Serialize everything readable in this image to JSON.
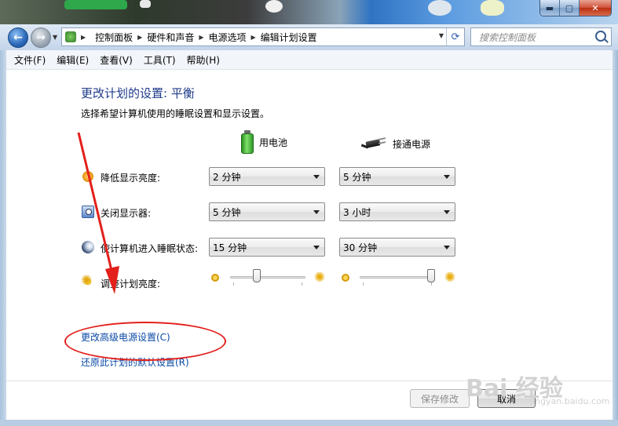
{
  "window": {
    "minimize_glyph": "▬",
    "maximize_glyph": "▢",
    "close_glyph": "✕"
  },
  "nav": {
    "breadcrumbs": [
      "控制面板",
      "硬件和声音",
      "电源选项",
      "编辑计划设置"
    ],
    "search_placeholder": "搜索控制面板"
  },
  "menu": [
    "文件(F)",
    "编辑(E)",
    "查看(V)",
    "工具(T)",
    "帮助(H)"
  ],
  "plan": {
    "title": "更改计划的设置: 平衡",
    "subtitle": "选择希望计算机使用的睡眠设置和显示设置。",
    "col_battery": "用电池",
    "col_plugged": "接通电源",
    "rows": [
      {
        "label": "降低显示亮度:",
        "battery": "2 分钟",
        "plugged": "5 分钟",
        "icon": "dim-display-icon"
      },
      {
        "label": "关闭显示器:",
        "battery": "5 分钟",
        "plugged": "3 小时",
        "icon": "monitor-icon"
      },
      {
        "label": "使计算机进入睡眠状态:",
        "battery": "15 分钟",
        "plugged": "30 分钟",
        "icon": "sleep-moon-icon"
      }
    ],
    "brightness_label": "调整计划亮度:",
    "brightness_battery": 0.35,
    "brightness_plugged": 1.0
  },
  "links": {
    "advanced": "更改高级电源设置(C)",
    "restore": "还原此计划的默认设置(R)"
  },
  "buttons": {
    "save": "保存修改",
    "cancel": "取消"
  },
  "watermark": {
    "main": "Bai 经验",
    "sub": "jingyan.baidu.com"
  },
  "annotation_color": "#e3201b"
}
